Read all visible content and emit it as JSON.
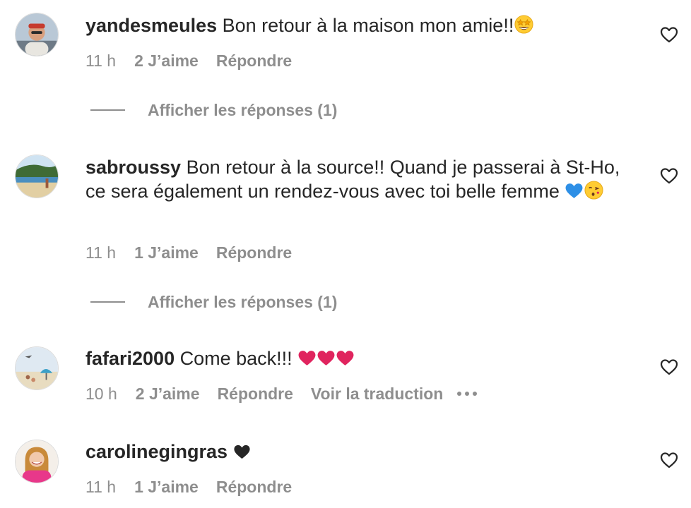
{
  "comments": [
    {
      "username": "yandesmeules",
      "text": "Bon retour à la maison mon amie!!",
      "emoji": [
        "star-struck"
      ],
      "time": "11 h",
      "likes": "2 J’aime",
      "reply": "Répondre",
      "replies_label": "Afficher les réponses (1)"
    },
    {
      "username": "sabroussy",
      "text": "Bon retour à la source!! Quand je passerai à St-Ho, ce sera également un rendez-vous avec toi belle femme",
      "emoji": [
        "blue-heart",
        "face-blowing-kiss"
      ],
      "time": "11 h",
      "likes": "1 J’aime",
      "reply": "Répondre",
      "replies_label": "Afficher les réponses (1)"
    },
    {
      "username": "fafari2000",
      "text": "Come back!!!",
      "emoji": [
        "red-heart",
        "red-heart",
        "red-heart"
      ],
      "time": "10 h",
      "likes": "2 J’aime",
      "reply": "Répondre",
      "translate": "Voir la traduction"
    },
    {
      "username": "carolinegingras",
      "text": "",
      "emoji": [
        "black-heart"
      ],
      "time": "11 h",
      "likes": "1 J’aime",
      "reply": "Répondre"
    }
  ],
  "icons": {
    "like": "heart-outline-icon",
    "more": "more-options-icon"
  },
  "colors": {
    "text": "#262626",
    "secondary": "#8e8e8e",
    "red_heart": "#e0245e",
    "blue_heart": "#2d8fe6"
  }
}
